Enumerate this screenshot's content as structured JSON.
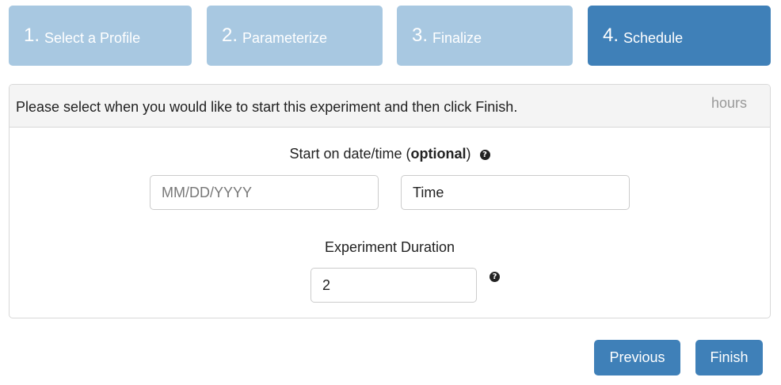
{
  "steps": [
    {
      "number": "1.",
      "label": "Select a Profile"
    },
    {
      "number": "2.",
      "label": "Parameterize"
    },
    {
      "number": "3.",
      "label": "Finalize"
    },
    {
      "number": "4.",
      "label": "Schedule"
    }
  ],
  "active_step": 4,
  "panel": {
    "message": "Please select when you would like to start this experiment and then click Finish.",
    "hours_text": "hours"
  },
  "start": {
    "label_prefix": "Start on date/time (",
    "label_bold": "optional",
    "label_suffix": ")",
    "date_placeholder": "MM/DD/YYYY",
    "time_value": "Time"
  },
  "duration": {
    "label": "Experiment Duration",
    "value": "2"
  },
  "help_glyph": "?",
  "buttons": {
    "previous": "Previous",
    "finish": "Finish"
  },
  "colors": {
    "step_inactive": "#a8c8e1",
    "step_active": "#3f80b8",
    "button": "#3f80b8"
  }
}
